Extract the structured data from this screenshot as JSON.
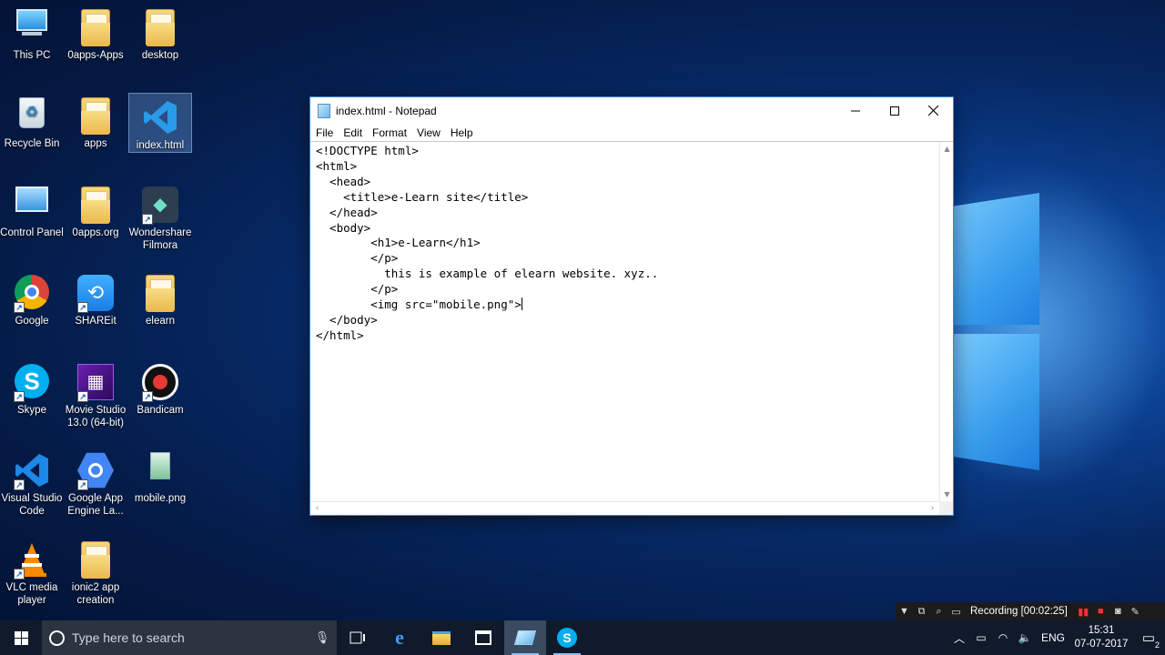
{
  "desktop": {
    "icons": [
      {
        "label": "This PC",
        "icon": "computer-icon"
      },
      {
        "label": "0apps-Apps",
        "icon": "folder-icon"
      },
      {
        "label": "desktop",
        "icon": "folder-icon"
      },
      {
        "label": "Recycle Bin",
        "icon": "recycle-bin-icon"
      },
      {
        "label": "apps",
        "icon": "folder-icon"
      },
      {
        "label": "index.html",
        "icon": "vscode-file-icon"
      },
      {
        "label": "Control Panel",
        "icon": "control-panel-icon"
      },
      {
        "label": "0apps.org",
        "icon": "folder-icon"
      },
      {
        "label": "Wondershare Filmora",
        "icon": "filmora-icon"
      },
      {
        "label": "Google",
        "icon": "chrome-icon"
      },
      {
        "label": "SHAREit",
        "icon": "shareit-icon"
      },
      {
        "label": "elearn",
        "icon": "folder-icon"
      },
      {
        "label": "Skype",
        "icon": "skype-icon"
      },
      {
        "label": "Movie Studio 13.0 (64-bit)",
        "icon": "movie-studio-icon"
      },
      {
        "label": "Bandicam",
        "icon": "bandicam-icon"
      },
      {
        "label": "Visual Studio Code",
        "icon": "vscode-icon"
      },
      {
        "label": "Google App Engine La...",
        "icon": "app-engine-icon"
      },
      {
        "label": "mobile.png",
        "icon": "image-file-icon"
      },
      {
        "label": "VLC media player",
        "icon": "vlc-icon"
      },
      {
        "label": "ionic2 app creation",
        "icon": "folder-icon"
      }
    ]
  },
  "notepad": {
    "title": "index.html - Notepad",
    "menu": [
      "File",
      "Edit",
      "Format",
      "View",
      "Help"
    ],
    "lines": [
      "<!DOCTYPE html>",
      "<html>",
      "  <head>",
      "    <title>e-Learn site</title>",
      "  </head>",
      "  <body>",
      "        <h1>e-Learn</h1>",
      "        </p>",
      "          this is example of elearn website. xyz..",
      "        </p>",
      "        <img src=\"mobile.png\">",
      "  </body>",
      "</html>"
    ]
  },
  "recording": {
    "text": "Recording [00:02:25]"
  },
  "taskbar": {
    "search_placeholder": "Type here to search",
    "apps": [
      "task-view-icon",
      "edge-icon",
      "file-explorer-icon",
      "store-icon",
      "notepad-icon",
      "skype-icon"
    ],
    "language": "ENG",
    "time": "15:31",
    "date": "07-07-2017",
    "notification_count": "2"
  },
  "colors": {
    "window_border": "#3c8ad8",
    "taskbar": "#101a2b",
    "desktop_accent": "#1f6fd0"
  }
}
